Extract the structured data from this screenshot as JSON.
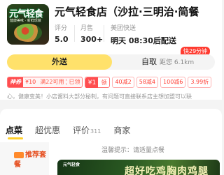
{
  "store": {
    "logo_text": "元气轻食",
    "logo_sub": "健康美味 · 新鲜现做",
    "name": "元气轻食店（沙拉·三明治·简餐",
    "stats": [
      {
        "label": "评分",
        "value": "5.0"
      },
      {
        "label": "月售",
        "value": "300+"
      },
      {
        "label": "美团快送",
        "value": "明天 08:30后配送"
      }
    ]
  },
  "delivery": {
    "delivery_label": "外送",
    "pickup_label": "自取",
    "pickup_distance": "距您 6.1km",
    "fast_badge": "快29分钟"
  },
  "promos": {
    "coupon_tag": "神券",
    "coupon_amount": "¥10",
    "coupon_condition": "满22可用",
    "coupon_status": "已领",
    "red_icon": "¥1",
    "red_label": "领",
    "discounts": [
      "40减2",
      "58减4",
      "100减6",
      "3.99折"
    ]
  },
  "notice": "心，健康变美！小店酱料大部分秘制，有问题可直接联系店主想加盟可以联",
  "tabs": [
    {
      "label": "点菜",
      "count": ""
    },
    {
      "label": "超优惠",
      "count": ""
    },
    {
      "label": "评价",
      "count": "311"
    },
    {
      "label": "商家",
      "count": ""
    }
  ],
  "sidebar": {
    "items": [
      {
        "label": "推荐套餐"
      }
    ]
  },
  "hint": "温馨提示：请适量点餐",
  "banner": {
    "brand": "元气轻食",
    "title": "超好吃鸡胸肉鸡腿"
  },
  "colors": {
    "accent": "#ffe16b",
    "badge_red": "#ff3b30",
    "tab_underline": "#ffd02b"
  }
}
